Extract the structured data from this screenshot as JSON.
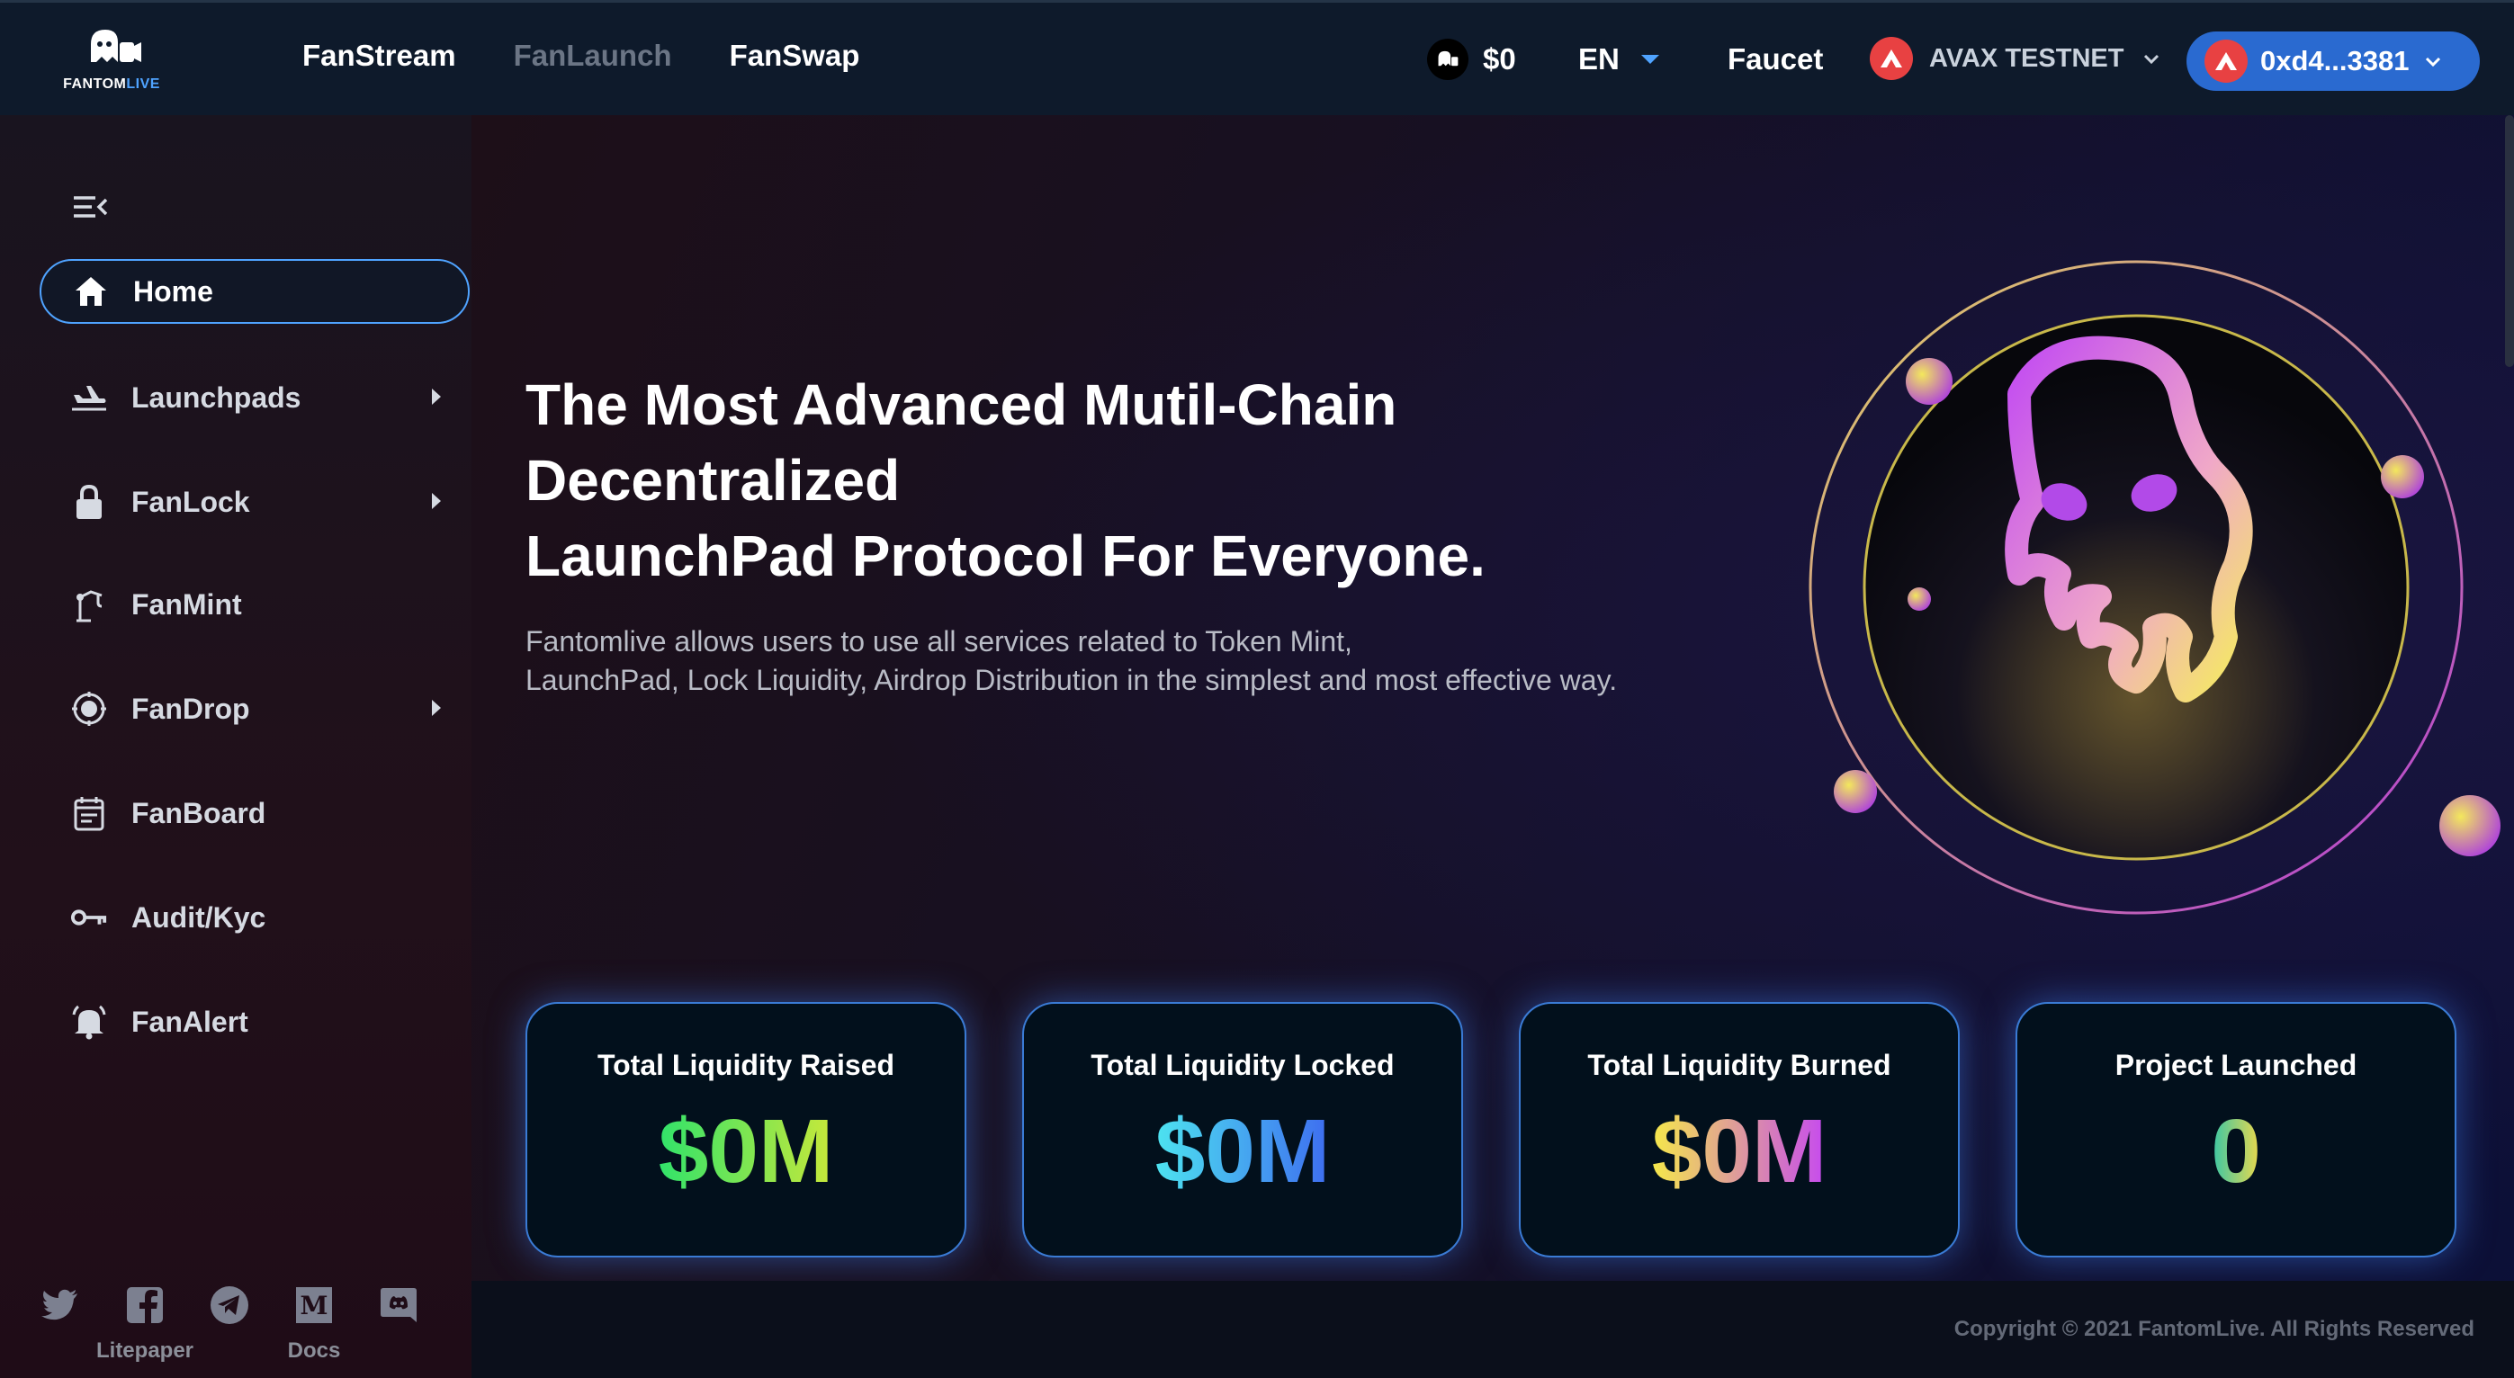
{
  "header": {
    "logo_text_main": "FANTOM",
    "logo_text_accent": "LIVE",
    "nav": [
      {
        "label": "FanStream"
      },
      {
        "label": "FanLaunch"
      },
      {
        "label": "FanSwap"
      }
    ],
    "balance": "$0",
    "language": "EN",
    "faucet": "Faucet",
    "network": "AVAX TESTNET",
    "wallet": "0xd4...3381"
  },
  "sidebar": {
    "items": [
      {
        "label": "Home",
        "icon": "home-icon"
      },
      {
        "label": "Launchpads",
        "icon": "plane-icon"
      },
      {
        "label": "FanLock",
        "icon": "lock-icon"
      },
      {
        "label": "FanMint",
        "icon": "crane-icon"
      },
      {
        "label": "FanDrop",
        "icon": "parachute-icon"
      },
      {
        "label": "FanBoard",
        "icon": "calendar-icon"
      },
      {
        "label": "Audit/Kyc",
        "icon": "key-icon"
      },
      {
        "label": "FanAlert",
        "icon": "bell-icon"
      }
    ],
    "socials": [
      {
        "icon": "twitter-icon",
        "label": ""
      },
      {
        "icon": "facebook-icon",
        "label": "Litepaper"
      },
      {
        "icon": "telegram-icon",
        "label": ""
      },
      {
        "icon": "medium-icon",
        "label": "Docs"
      },
      {
        "icon": "discord-icon",
        "label": ""
      }
    ]
  },
  "hero": {
    "title_line1": "The Most Advanced Mutil-Chain",
    "title_line2": "Decentralized",
    "title_line3": "LaunchPad Protocol For Everyone.",
    "subtitle_line1": "Fantomlive allows users to use all services related to Token Mint,",
    "subtitle_line2": "LaunchPad, Lock Liquidity, Airdrop Distribution in the simplest and most effective way."
  },
  "stats": [
    {
      "label": "Total Liquidity Raised",
      "value": "$0M"
    },
    {
      "label": "Total Liquidity Locked",
      "value": "$0M"
    },
    {
      "label": "Total Liquidity Burned",
      "value": "$0M"
    },
    {
      "label": "Project Launched",
      "value": "0"
    }
  ],
  "footer": {
    "copyright": "Copyright © 2021 FantomLive. All Rights Reserved"
  },
  "colors": {
    "accent": "#4fa3ff",
    "wallet_button": "#2a6ad0",
    "avax_red": "#e84142",
    "topbar": "#0e1a2b"
  }
}
